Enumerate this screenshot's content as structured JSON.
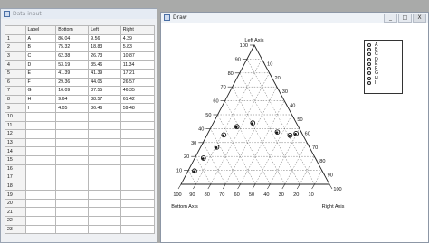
{
  "data_window": {
    "title": "Data input",
    "columns": [
      "",
      "Label",
      "Bottom",
      "Left",
      "Right"
    ],
    "rows": [
      [
        "1",
        "A",
        "86.04",
        "9.56",
        "4.39"
      ],
      [
        "2",
        "B",
        "75.32",
        "18.83",
        "5.83"
      ],
      [
        "3",
        "C",
        "62.38",
        "26.73",
        "10.87"
      ],
      [
        "4",
        "D",
        "53.19",
        "35.46",
        "11.34"
      ],
      [
        "5",
        "E",
        "41.39",
        "41.39",
        "17.21"
      ],
      [
        "6",
        "F",
        "29.36",
        "44.05",
        "26.57"
      ],
      [
        "7",
        "G",
        "16.09",
        "37.55",
        "46.35"
      ],
      [
        "8",
        "H",
        "9.64",
        "38.57",
        "61.42"
      ],
      [
        "9",
        "I",
        "4.05",
        "36.46",
        "59.48"
      ],
      [
        "10",
        "",
        "",
        "",
        ""
      ],
      [
        "11",
        "",
        "",
        "",
        ""
      ],
      [
        "12",
        "",
        "",
        "",
        ""
      ],
      [
        "13",
        "",
        "",
        "",
        ""
      ],
      [
        "14",
        "",
        "",
        "",
        ""
      ],
      [
        "15",
        "",
        "",
        "",
        ""
      ],
      [
        "16",
        "",
        "",
        "",
        ""
      ],
      [
        "17",
        "",
        "",
        "",
        ""
      ],
      [
        "18",
        "",
        "",
        "",
        ""
      ],
      [
        "19",
        "",
        "",
        "",
        ""
      ],
      [
        "20",
        "",
        "",
        "",
        ""
      ],
      [
        "21",
        "",
        "",
        "",
        ""
      ],
      [
        "22",
        "",
        "",
        "",
        ""
      ],
      [
        "23",
        "",
        "",
        "",
        ""
      ]
    ]
  },
  "draw_window": {
    "title": "Draw",
    "buttons": {
      "minimize": "_",
      "maximize": "□",
      "close": "X"
    }
  },
  "chart_data": {
    "type": "scatter",
    "subtype": "ternary",
    "axis_labels": {
      "left": "Left Axis",
      "bottom": "Bottom Axis",
      "right": "Right Axis"
    },
    "ticks": [
      10,
      20,
      30,
      40,
      50,
      60,
      70,
      80,
      90,
      100
    ],
    "grid": true,
    "legend_position": "right",
    "points": [
      {
        "label": "A",
        "bottom": 86.04,
        "left": 9.56,
        "right": 4.39
      },
      {
        "label": "B",
        "bottom": 75.32,
        "left": 18.83,
        "right": 5.83
      },
      {
        "label": "C",
        "bottom": 62.38,
        "left": 26.73,
        "right": 10.87
      },
      {
        "label": "D",
        "bottom": 53.19,
        "left": 35.46,
        "right": 11.34
      },
      {
        "label": "E",
        "bottom": 41.39,
        "left": 41.39,
        "right": 17.21
      },
      {
        "label": "F",
        "bottom": 29.36,
        "left": 44.05,
        "right": 26.57
      },
      {
        "label": "G",
        "bottom": 16.09,
        "left": 37.55,
        "right": 46.35
      },
      {
        "label": "H",
        "bottom": 9.64,
        "left": 38.57,
        "right": 61.42
      },
      {
        "label": "I",
        "bottom": 4.05,
        "left": 36.46,
        "right": 59.48
      }
    ]
  }
}
